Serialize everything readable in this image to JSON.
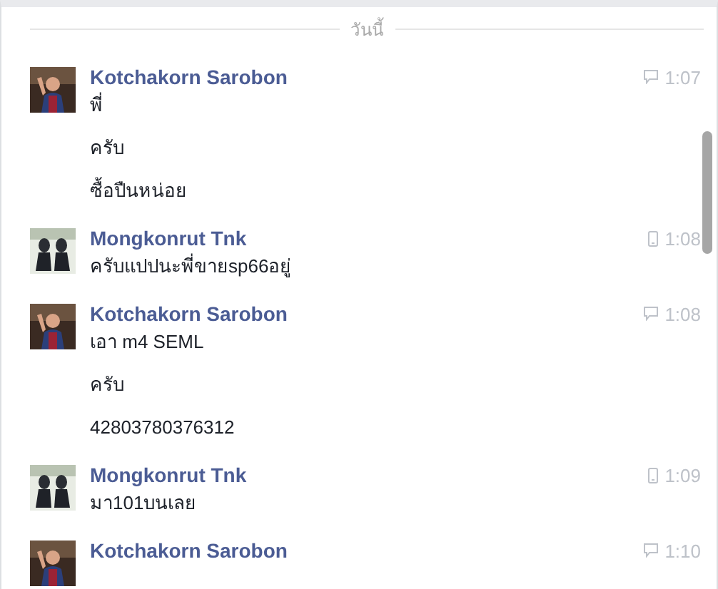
{
  "divider": {
    "label": "วันนี้"
  },
  "groups": [
    {
      "sender": "Kotchakorn Sarobon",
      "avatar": {
        "kind": "portrait"
      },
      "kind": "web",
      "time": "1:07",
      "lines": [
        "พี่",
        "ครับ",
        "ซื้อปืนหน่อย"
      ]
    },
    {
      "sender": "Mongkonrut Tnk",
      "avatar": {
        "kind": "figures"
      },
      "kind": "mobile",
      "time": "1:08",
      "lines": [
        "ครับแปปนะพี่ขายsp66อยู่"
      ]
    },
    {
      "sender": "Kotchakorn Sarobon",
      "avatar": {
        "kind": "portrait"
      },
      "kind": "web",
      "time": "1:08",
      "lines": [
        "เอา m4 SEML",
        "ครับ",
        "42803780376312"
      ]
    },
    {
      "sender": "Mongkonrut Tnk",
      "avatar": {
        "kind": "figures"
      },
      "kind": "mobile",
      "time": "1:09",
      "lines": [
        "มา101บนเลย"
      ]
    },
    {
      "sender": "Kotchakorn Sarobon",
      "avatar": {
        "kind": "portrait"
      },
      "kind": "web",
      "time": "1:10"
    }
  ]
}
